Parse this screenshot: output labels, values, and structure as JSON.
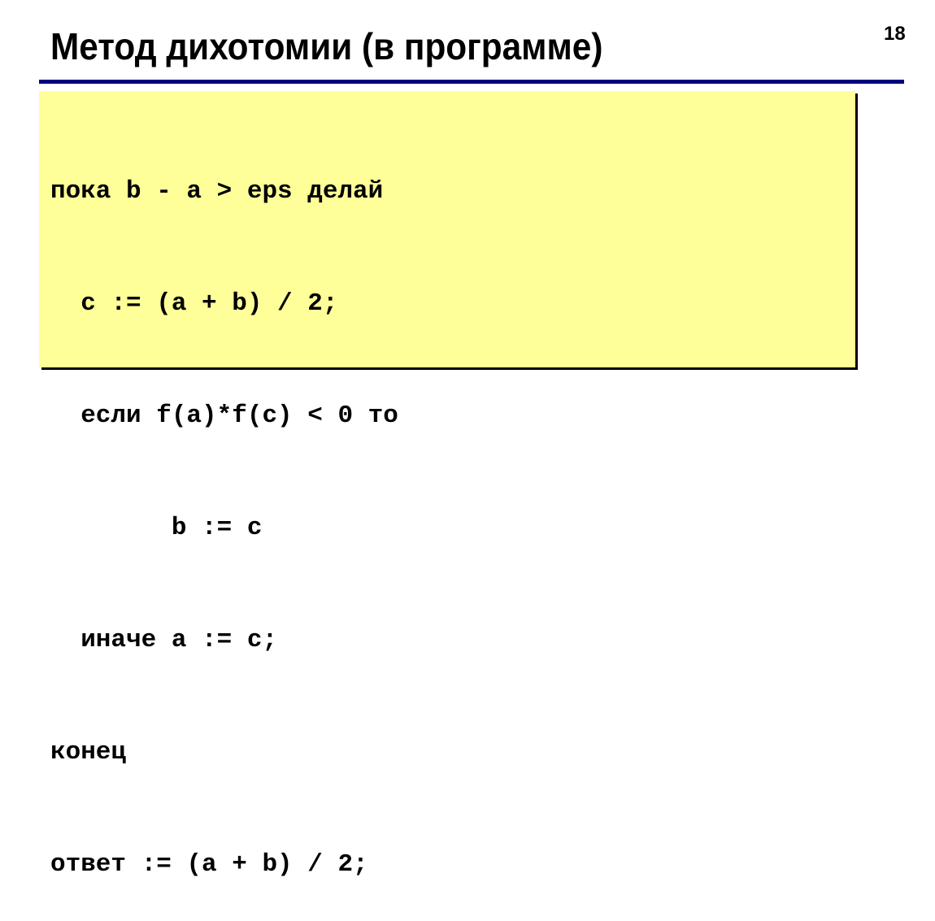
{
  "slide": {
    "title": "Метод дихотомии (в программе)",
    "page_number": "18",
    "colors": {
      "rule": "#000080",
      "code_background": "#ffff99",
      "text": "#000000"
    }
  },
  "code": {
    "lines": [
      "пока b - a > eps делай",
      "  c := (a + b) / 2;",
      "  если f(a)*f(c) < 0 то",
      "        b := c",
      "  иначе a := c;",
      "конец",
      "ответ := (a + b) / 2;"
    ]
  }
}
